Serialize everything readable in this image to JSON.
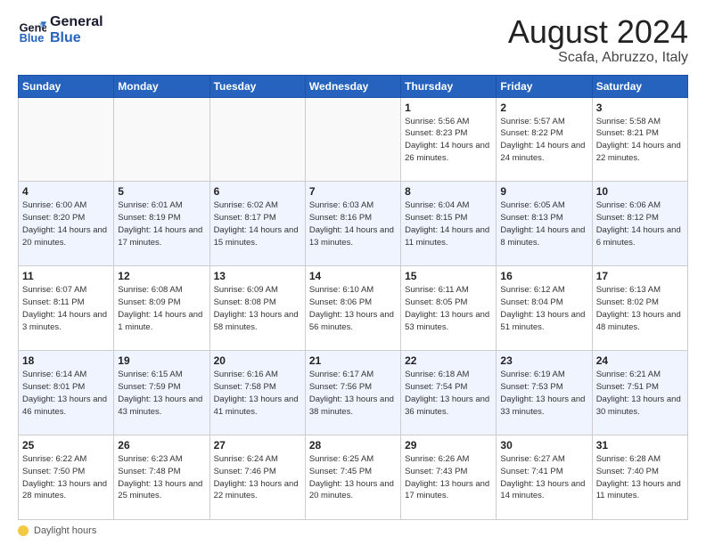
{
  "logo": {
    "general": "General",
    "blue": "Blue"
  },
  "header": {
    "month_year": "August 2024",
    "location": "Scafa, Abruzzo, Italy"
  },
  "weekdays": [
    "Sunday",
    "Monday",
    "Tuesday",
    "Wednesday",
    "Thursday",
    "Friday",
    "Saturday"
  ],
  "weeks": [
    [
      {
        "day": "",
        "info": ""
      },
      {
        "day": "",
        "info": ""
      },
      {
        "day": "",
        "info": ""
      },
      {
        "day": "",
        "info": ""
      },
      {
        "day": "1",
        "info": "Sunrise: 5:56 AM\nSunset: 8:23 PM\nDaylight: 14 hours and 26 minutes."
      },
      {
        "day": "2",
        "info": "Sunrise: 5:57 AM\nSunset: 8:22 PM\nDaylight: 14 hours and 24 minutes."
      },
      {
        "day": "3",
        "info": "Sunrise: 5:58 AM\nSunset: 8:21 PM\nDaylight: 14 hours and 22 minutes."
      }
    ],
    [
      {
        "day": "4",
        "info": "Sunrise: 6:00 AM\nSunset: 8:20 PM\nDaylight: 14 hours and 20 minutes."
      },
      {
        "day": "5",
        "info": "Sunrise: 6:01 AM\nSunset: 8:19 PM\nDaylight: 14 hours and 17 minutes."
      },
      {
        "day": "6",
        "info": "Sunrise: 6:02 AM\nSunset: 8:17 PM\nDaylight: 14 hours and 15 minutes."
      },
      {
        "day": "7",
        "info": "Sunrise: 6:03 AM\nSunset: 8:16 PM\nDaylight: 14 hours and 13 minutes."
      },
      {
        "day": "8",
        "info": "Sunrise: 6:04 AM\nSunset: 8:15 PM\nDaylight: 14 hours and 11 minutes."
      },
      {
        "day": "9",
        "info": "Sunrise: 6:05 AM\nSunset: 8:13 PM\nDaylight: 14 hours and 8 minutes."
      },
      {
        "day": "10",
        "info": "Sunrise: 6:06 AM\nSunset: 8:12 PM\nDaylight: 14 hours and 6 minutes."
      }
    ],
    [
      {
        "day": "11",
        "info": "Sunrise: 6:07 AM\nSunset: 8:11 PM\nDaylight: 14 hours and 3 minutes."
      },
      {
        "day": "12",
        "info": "Sunrise: 6:08 AM\nSunset: 8:09 PM\nDaylight: 14 hours and 1 minute."
      },
      {
        "day": "13",
        "info": "Sunrise: 6:09 AM\nSunset: 8:08 PM\nDaylight: 13 hours and 58 minutes."
      },
      {
        "day": "14",
        "info": "Sunrise: 6:10 AM\nSunset: 8:06 PM\nDaylight: 13 hours and 56 minutes."
      },
      {
        "day": "15",
        "info": "Sunrise: 6:11 AM\nSunset: 8:05 PM\nDaylight: 13 hours and 53 minutes."
      },
      {
        "day": "16",
        "info": "Sunrise: 6:12 AM\nSunset: 8:04 PM\nDaylight: 13 hours and 51 minutes."
      },
      {
        "day": "17",
        "info": "Sunrise: 6:13 AM\nSunset: 8:02 PM\nDaylight: 13 hours and 48 minutes."
      }
    ],
    [
      {
        "day": "18",
        "info": "Sunrise: 6:14 AM\nSunset: 8:01 PM\nDaylight: 13 hours and 46 minutes."
      },
      {
        "day": "19",
        "info": "Sunrise: 6:15 AM\nSunset: 7:59 PM\nDaylight: 13 hours and 43 minutes."
      },
      {
        "day": "20",
        "info": "Sunrise: 6:16 AM\nSunset: 7:58 PM\nDaylight: 13 hours and 41 minutes."
      },
      {
        "day": "21",
        "info": "Sunrise: 6:17 AM\nSunset: 7:56 PM\nDaylight: 13 hours and 38 minutes."
      },
      {
        "day": "22",
        "info": "Sunrise: 6:18 AM\nSunset: 7:54 PM\nDaylight: 13 hours and 36 minutes."
      },
      {
        "day": "23",
        "info": "Sunrise: 6:19 AM\nSunset: 7:53 PM\nDaylight: 13 hours and 33 minutes."
      },
      {
        "day": "24",
        "info": "Sunrise: 6:21 AM\nSunset: 7:51 PM\nDaylight: 13 hours and 30 minutes."
      }
    ],
    [
      {
        "day": "25",
        "info": "Sunrise: 6:22 AM\nSunset: 7:50 PM\nDaylight: 13 hours and 28 minutes."
      },
      {
        "day": "26",
        "info": "Sunrise: 6:23 AM\nSunset: 7:48 PM\nDaylight: 13 hours and 25 minutes."
      },
      {
        "day": "27",
        "info": "Sunrise: 6:24 AM\nSunset: 7:46 PM\nDaylight: 13 hours and 22 minutes."
      },
      {
        "day": "28",
        "info": "Sunrise: 6:25 AM\nSunset: 7:45 PM\nDaylight: 13 hours and 20 minutes."
      },
      {
        "day": "29",
        "info": "Sunrise: 6:26 AM\nSunset: 7:43 PM\nDaylight: 13 hours and 17 minutes."
      },
      {
        "day": "30",
        "info": "Sunrise: 6:27 AM\nSunset: 7:41 PM\nDaylight: 13 hours and 14 minutes."
      },
      {
        "day": "31",
        "info": "Sunrise: 6:28 AM\nSunset: 7:40 PM\nDaylight: 13 hours and 11 minutes."
      }
    ]
  ],
  "footer": {
    "label": "Daylight hours"
  }
}
